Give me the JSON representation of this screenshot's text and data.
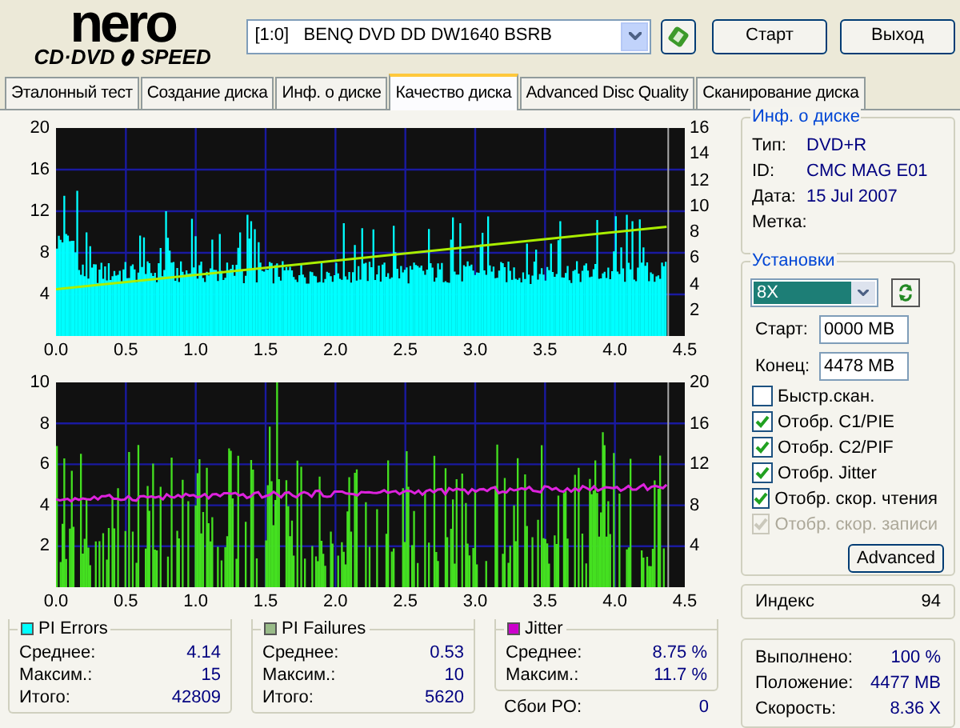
{
  "logo": {
    "title": "nero",
    "subtitle_left": "CD·DVD",
    "subtitle_right": "SPEED"
  },
  "drive": {
    "value": "[1:0]   BENQ DVD DD DW1640 BSRB"
  },
  "buttons": [
    "Старт",
    "Выход"
  ],
  "tabs": [
    {
      "label": "Эталонный тест",
      "selected": false
    },
    {
      "label": "Создание диска",
      "selected": false
    },
    {
      "label": "Инф. о диске",
      "selected": false
    },
    {
      "label": "Качество диска",
      "selected": true
    },
    {
      "label": "Advanced Disc Quality",
      "selected": false
    },
    {
      "label": "Сканирование диска",
      "selected": false
    }
  ],
  "charts": [
    {
      "kind": "errors",
      "y_left_ticks": [
        "20",
        "16",
        "12",
        "8",
        "4"
      ],
      "y_right_ticks": [
        "16",
        "14",
        "12",
        "10",
        "8",
        "6",
        "4",
        "2"
      ],
      "x_ticks": [
        "0.0",
        "0.5",
        "1.0",
        "1.5",
        "2.0",
        "2.5",
        "3.0",
        "3.5",
        "4.0",
        "4.5"
      ]
    },
    {
      "kind": "failures",
      "y_left_ticks": [
        "10",
        "8",
        "6",
        "4",
        "2"
      ],
      "y_right_ticks": [
        "20",
        "16",
        "12",
        "8",
        "4"
      ],
      "x_ticks": [
        "0.0",
        "0.5",
        "1.0",
        "1.5",
        "2.0",
        "2.5",
        "3.0",
        "3.5",
        "4.0",
        "4.5"
      ]
    }
  ],
  "stats": [
    {
      "title": "PI Errors",
      "color": "#00ffff",
      "rows": [
        {
          "label": "Среднее:",
          "value": "4.14"
        },
        {
          "label": "Максим.:",
          "value": "15"
        },
        {
          "label": "Итого:",
          "value": "42809"
        }
      ]
    },
    {
      "title": "PI Failures",
      "color": "#99bb88",
      "rows": [
        {
          "label": "Среднее:",
          "value": "0.53"
        },
        {
          "label": "Максим.:",
          "value": "10"
        },
        {
          "label": "Итого:",
          "value": "5620"
        }
      ]
    },
    {
      "title": "Jitter",
      "color": "#cc00cc",
      "rows": [
        {
          "label": "Среднее:",
          "value": "8.75 %"
        },
        {
          "label": "Максим.:",
          "value": "11.7 %"
        }
      ]
    }
  ],
  "po_failures": {
    "label": "Сбои PO:",
    "value": "0"
  },
  "disc_info": {
    "title": "Инф. о диске",
    "rows": [
      {
        "label": "Тип:",
        "value": "DVD+R"
      },
      {
        "label": "ID:",
        "value": "CMC MAG E01"
      },
      {
        "label": "Дата:",
        "value": "15 Jul 2007"
      },
      {
        "label": "Метка:"
      }
    ]
  },
  "settings": {
    "title": "Установки",
    "speed": "8X",
    "start_label": "Старт:",
    "start": "0000 MB",
    "end_label": "Конец:",
    "end": "4478 MB",
    "options": [
      {
        "label": "Быстр.скан.",
        "checked": false,
        "disabled": false
      },
      {
        "label": "Отобр. C1/PIE",
        "checked": true,
        "disabled": false
      },
      {
        "label": "Отобр. C2/PIF",
        "checked": true,
        "disabled": false
      },
      {
        "label": "Отобр. Jitter",
        "checked": true,
        "disabled": false
      },
      {
        "label": "Отобр. скор. чтения",
        "checked": true,
        "disabled": false
      },
      {
        "label": "Отобр. скор. записи",
        "checked": true,
        "disabled": true
      }
    ],
    "advanced": "Advanced"
  },
  "index": {
    "label": "Индекс",
    "value": "94"
  },
  "summary": [
    {
      "label": "Выполнено:",
      "value": "100 %"
    },
    {
      "label": "Положение:",
      "value": "4477 MB"
    },
    {
      "label": "Скорость:",
      "value": "8.36 X"
    }
  ]
}
